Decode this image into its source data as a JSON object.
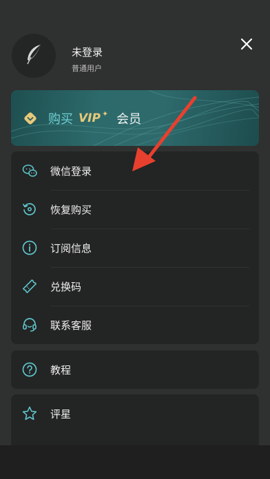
{
  "header": {
    "user_name": "未登录",
    "user_type": "普通用户",
    "avatar_icon": "feather-icon",
    "close_icon": "close-icon"
  },
  "vip_banner": {
    "buy_label": "购买",
    "vip_tag": "VIP",
    "star": "✦",
    "member_label": "会员",
    "icon": "diamond-icon"
  },
  "menu_group_1": [
    {
      "label": "微信登录",
      "icon": "wechat-icon"
    },
    {
      "label": "恢复购买",
      "icon": "restore-icon"
    },
    {
      "label": "订阅信息",
      "icon": "info-icon"
    },
    {
      "label": "兑换码",
      "icon": "ticket-icon"
    },
    {
      "label": "联系客服",
      "icon": "headset-icon"
    }
  ],
  "menu_group_2": [
    {
      "label": "教程",
      "icon": "help-icon"
    }
  ],
  "menu_group_3": [
    {
      "label": "评星",
      "icon": "star-icon"
    }
  ],
  "colors": {
    "accent_cyan": "#5ec6cc",
    "vip_gold": "#e6c97a",
    "arrow_red": "#e8402e",
    "panel_bg": "#2f3030",
    "card_bg": "#232424"
  }
}
